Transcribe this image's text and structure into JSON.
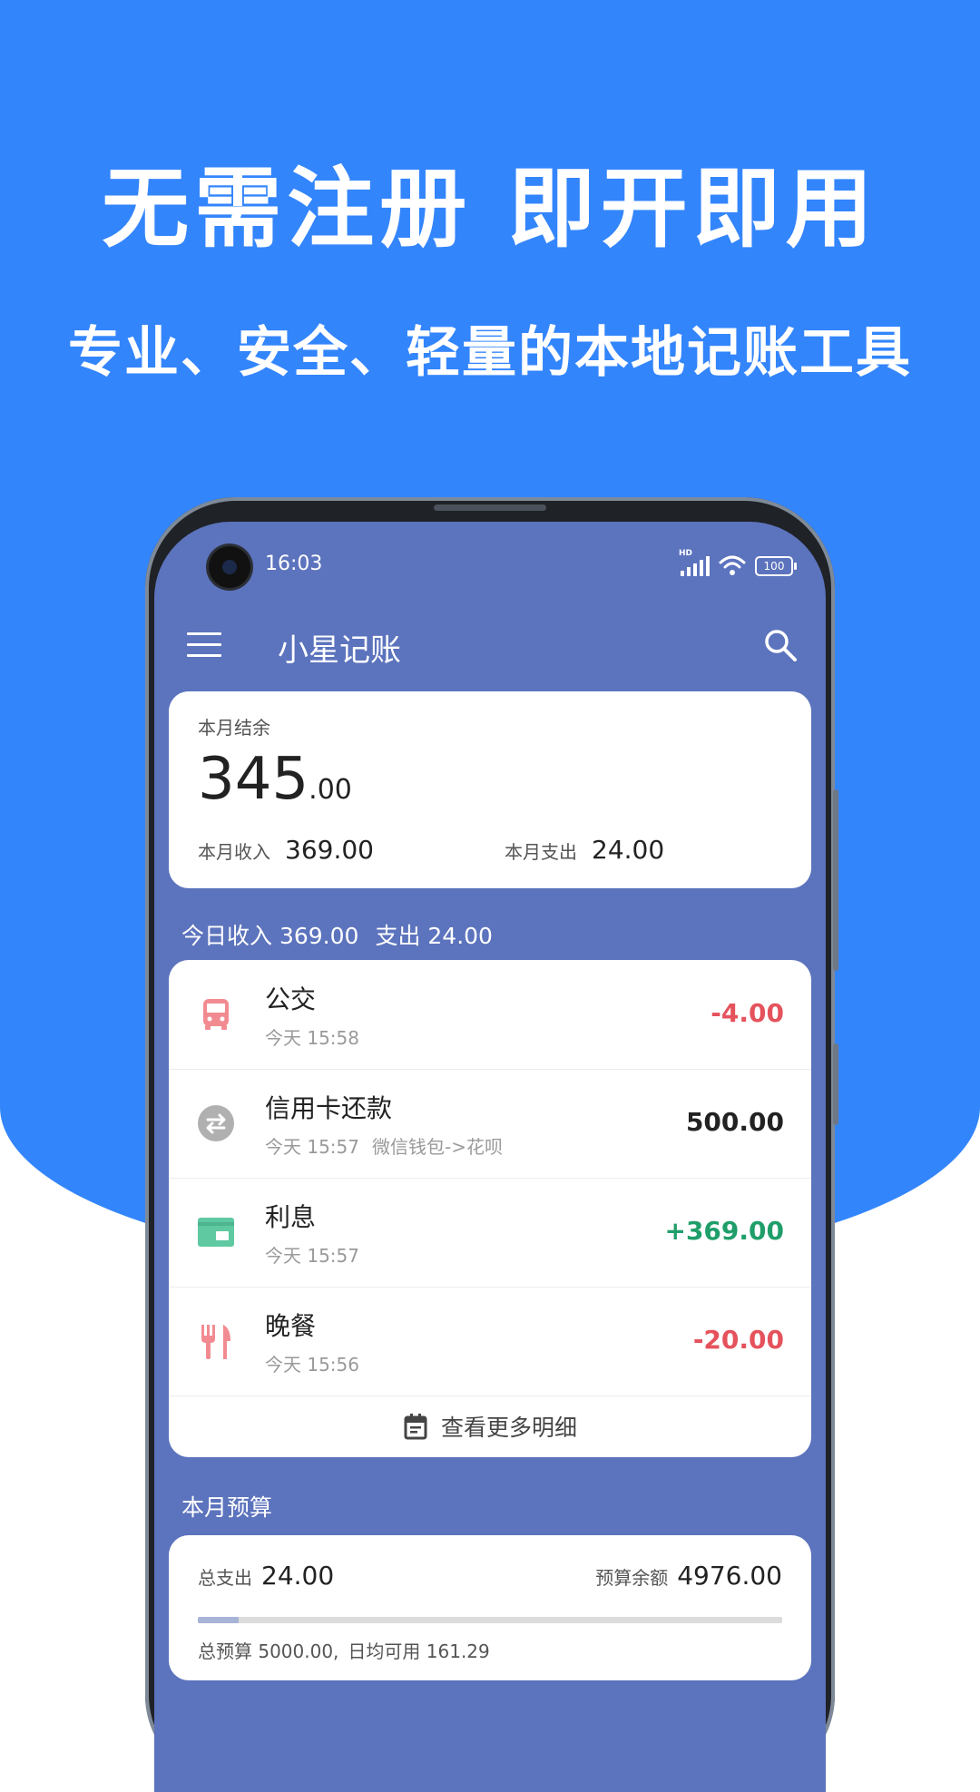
{
  "promo": {
    "headline": "无需注册 即开即用",
    "subheadline": "专业、安全、轻量的本地记账工具"
  },
  "status_bar": {
    "time": "16:03",
    "hd": "HD",
    "battery": "100"
  },
  "app_bar": {
    "title": "小星记账",
    "menu_icon": "menu-icon",
    "search_icon": "search-icon"
  },
  "balance": {
    "label": "本月结余",
    "amount_int": "345",
    "amount_frac": ".00",
    "income_label": "本月收入",
    "income_value": "369.00",
    "expense_label": "本月支出",
    "expense_value": "24.00"
  },
  "today": {
    "income_text": "今日收入 369.00",
    "expense_text": "支出 24.00"
  },
  "transactions": [
    {
      "name": "公交",
      "time": "今天 15:58",
      "note": "",
      "amount": "-4.00",
      "color": "#e5525c",
      "icon": "bus-icon",
      "icon_color": "#f28b91"
    },
    {
      "name": "信用卡还款",
      "time": "今天 15:57",
      "note": "微信钱包->花呗",
      "amount": "500.00",
      "color": "#222222",
      "icon": "transfer-icon",
      "icon_color": "#b0b0b0"
    },
    {
      "name": "利息",
      "time": "今天 15:57",
      "note": "",
      "amount": "+369.00",
      "color": "#1f9e6a",
      "icon": "wallet-icon",
      "icon_color": "#5fc9a2"
    },
    {
      "name": "晚餐",
      "time": "今天 15:56",
      "note": "",
      "amount": "-20.00",
      "color": "#e5525c",
      "icon": "cutlery-icon",
      "icon_color": "#f28b91"
    }
  ],
  "more_link": {
    "label": "查看更多明细",
    "icon": "calendar-icon"
  },
  "budget": {
    "header": "本月预算",
    "total_label": "总支出",
    "total_value": "24.00",
    "remaining_label": "预算余额",
    "remaining_value": "4976.00",
    "progress_fraction": 0.0048,
    "note_total": "总预算 5000.00,",
    "note_daily": "日均可用 161.29"
  }
}
